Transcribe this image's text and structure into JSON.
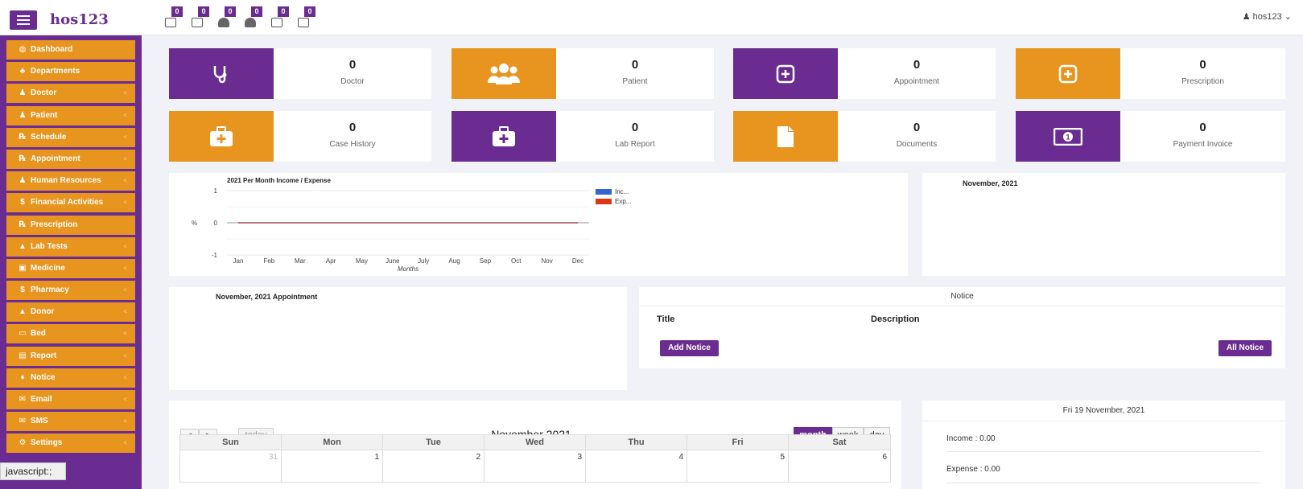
{
  "app": {
    "title": "hos123",
    "user": "hos123 ⌄"
  },
  "quick_badges": [
    "0",
    "0",
    "0",
    "0",
    "0",
    "0"
  ],
  "sidebar": [
    {
      "label": "Dashboard",
      "icon": "dashboard-icon",
      "glyph": "◍",
      "has_children": false
    },
    {
      "label": "Departments",
      "icon": "sitemap-icon",
      "glyph": "♣",
      "has_children": false
    },
    {
      "label": "Doctor",
      "icon": "users-icon",
      "glyph": "♟",
      "has_children": true
    },
    {
      "label": "Patient",
      "icon": "users-icon",
      "glyph": "♟",
      "has_children": true
    },
    {
      "label": "Schedule",
      "icon": "stethoscope-icon",
      "glyph": "℞",
      "has_children": true
    },
    {
      "label": "Appointment",
      "icon": "stethoscope-icon",
      "glyph": "℞",
      "has_children": true
    },
    {
      "label": "Human Resources",
      "icon": "users-icon",
      "glyph": "♟",
      "has_children": true
    },
    {
      "label": "Financial Activities",
      "icon": "dollar-icon",
      "glyph": "$",
      "has_children": true
    },
    {
      "label": "Prescription",
      "icon": "stethoscope-icon",
      "glyph": "℞",
      "has_children": false
    },
    {
      "label": "Lab Tests",
      "icon": "flask-icon",
      "glyph": "▲",
      "has_children": true
    },
    {
      "label": "Medicine",
      "icon": "money-icon",
      "glyph": "▣",
      "has_children": true
    },
    {
      "label": "Pharmacy",
      "icon": "dollar-icon",
      "glyph": "$",
      "has_children": true
    },
    {
      "label": "Donor",
      "icon": "user-icon",
      "glyph": "▲",
      "has_children": true
    },
    {
      "label": "Bed",
      "icon": "bed-icon",
      "glyph": "▭",
      "has_children": true
    },
    {
      "label": "Report",
      "icon": "report-icon",
      "glyph": "▤",
      "has_children": true
    },
    {
      "label": "Notice",
      "icon": "notice-icon",
      "glyph": "♦",
      "has_children": true
    },
    {
      "label": "Email",
      "icon": "envelope-icon",
      "glyph": "✉",
      "has_children": true
    },
    {
      "label": "SMS",
      "icon": "envelope-icon",
      "glyph": "✉",
      "has_children": true
    },
    {
      "label": "Settings",
      "icon": "gears-icon",
      "glyph": "⚙",
      "has_children": true
    }
  ],
  "status_hint": "javascript:;",
  "stats": [
    {
      "value": "0",
      "label": "Doctor",
      "icon": "stethoscope-icon",
      "color": "#6b2c91"
    },
    {
      "value": "0",
      "label": "Patient",
      "icon": "users-icon",
      "color": "#e8951f"
    },
    {
      "value": "0",
      "label": "Appointment",
      "icon": "plus-square-icon",
      "color": "#6b2c91"
    },
    {
      "value": "0",
      "label": "Prescription",
      "icon": "plus-square-icon",
      "color": "#e8951f"
    },
    {
      "value": "0",
      "label": "Case History",
      "icon": "medkit-icon",
      "color": "#e8951f"
    },
    {
      "value": "0",
      "label": "Lab Report",
      "icon": "medkit-icon",
      "color": "#6b2c91"
    },
    {
      "value": "0",
      "label": "Documents",
      "icon": "file-icon",
      "color": "#e8951f"
    },
    {
      "value": "0",
      "label": "Payment Invoice",
      "icon": "money-icon",
      "color": "#6b2c91"
    }
  ],
  "chart_data": {
    "type": "line",
    "title": "2021 Per Month Income / Expense",
    "xlabel": "Months",
    "ylabel": "%",
    "categories": [
      "Jan",
      "Feb",
      "Mar",
      "Apr",
      "May",
      "June",
      "July",
      "Aug",
      "Sep",
      "Oct",
      "Nov",
      "Dec"
    ],
    "series": [
      {
        "name": "Inc...",
        "color": "#3366cc",
        "values": [
          0,
          0,
          0,
          0,
          0,
          0,
          0,
          0,
          0,
          0,
          0,
          0
        ]
      },
      {
        "name": "Exp...",
        "color": "#dc3912",
        "values": [
          0,
          0,
          0,
          0,
          0,
          0,
          0,
          0,
          0,
          0,
          0,
          0
        ]
      }
    ],
    "ylim": [
      -1,
      1
    ],
    "yticks": [
      "1",
      "0",
      "-1"
    ],
    "legend": "right",
    "grid": true
  },
  "monthly_panel": {
    "title": "November, 2021"
  },
  "appointment_panel": {
    "title": "November, 2021 Appointment"
  },
  "notice": {
    "title": "Notice",
    "col_title": "Title",
    "col_description": "Description",
    "add_label": "Add Notice",
    "all_label": "All Notice"
  },
  "calendar": {
    "title": "November 2021",
    "today_label": "today",
    "prev": "<",
    "next": ">",
    "views": [
      "month",
      "week",
      "day"
    ],
    "active_view": "month",
    "weekdays": [
      "Sun",
      "Mon",
      "Tue",
      "Wed",
      "Thu",
      "Fri",
      "Sat"
    ],
    "first_row": [
      "31",
      "1",
      "2",
      "3",
      "4",
      "5",
      "6"
    ]
  },
  "summary": {
    "date": "Fri 19 November, 2021",
    "income": "Income : 0.00",
    "expense": "Expense : 0.00"
  }
}
